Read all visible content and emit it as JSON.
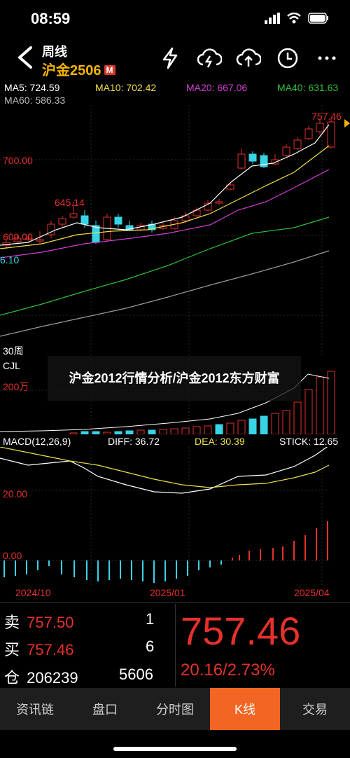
{
  "status": {
    "time": "08:59"
  },
  "header": {
    "title": "周线",
    "symbol": "沪金2506",
    "badge": "M"
  },
  "ma": {
    "ma5": "MA5: 724.59",
    "ma10": "MA10: 702.42",
    "ma20": "MA20: 667.06",
    "ma40": "MA40: 631.63",
    "ma60": "MA60: 586.33"
  },
  "kline": {
    "high_label": "757.46",
    "y700": "700.00",
    "y600": "600.00",
    "local_high": "645.14",
    "low_label": "6.10",
    "period": "30周"
  },
  "volume": {
    "name": "CJL",
    "y_label": "200万"
  },
  "macd": {
    "title": "MACD(12,26,9)",
    "diff": "DIFF: 36.72",
    "dea": "DEA: 30.39",
    "stick": "STICK: 12.65",
    "y20": "20.00",
    "y0": "0.00"
  },
  "xaxis": {
    "d1": "2024/10",
    "d2": "2025/01",
    "d3": "2025/04"
  },
  "overlay": {
    "title": "沪金2012行情分析/沪金2012东方财富"
  },
  "quote": {
    "sell_label": "卖",
    "sell_price": "757.50",
    "sell_qty": "1",
    "buy_label": "买",
    "buy_price": "757.46",
    "buy_qty": "6",
    "oi_label": "仓",
    "oi_value": "206239",
    "oi_change": "5606",
    "last": "757.46",
    "change": "20.16/2.73%"
  },
  "tabs": [
    {
      "label": "资讯链"
    },
    {
      "label": "盘口"
    },
    {
      "label": "分时图"
    },
    {
      "label": "K线"
    },
    {
      "label": "交易"
    }
  ],
  "colors": {
    "up": "#e5312b",
    "down": "#39d3e6",
    "ma5": "#ffffff",
    "ma10": "#f0e04a",
    "ma20": "#d33fd6",
    "ma40": "#2fbf3a",
    "accent": "#f26522"
  }
}
